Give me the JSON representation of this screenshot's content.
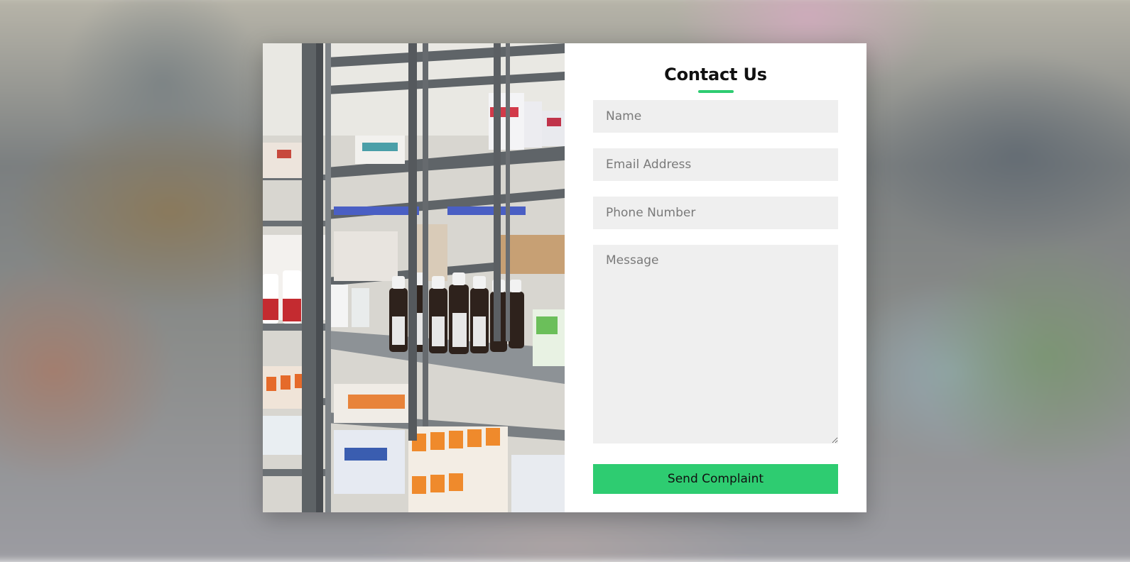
{
  "form": {
    "title": "Contact Us",
    "name_placeholder": "Name",
    "email_placeholder": "Email Address",
    "phone_placeholder": "Phone Number",
    "message_placeholder": "Message",
    "submit_label": "Send Complaint"
  },
  "colors": {
    "accent": "#2ecc71",
    "field_bg": "#efefef",
    "panel_bg": "#ffffff"
  },
  "image": {
    "subject": "pharmacy-shelves-photo"
  }
}
